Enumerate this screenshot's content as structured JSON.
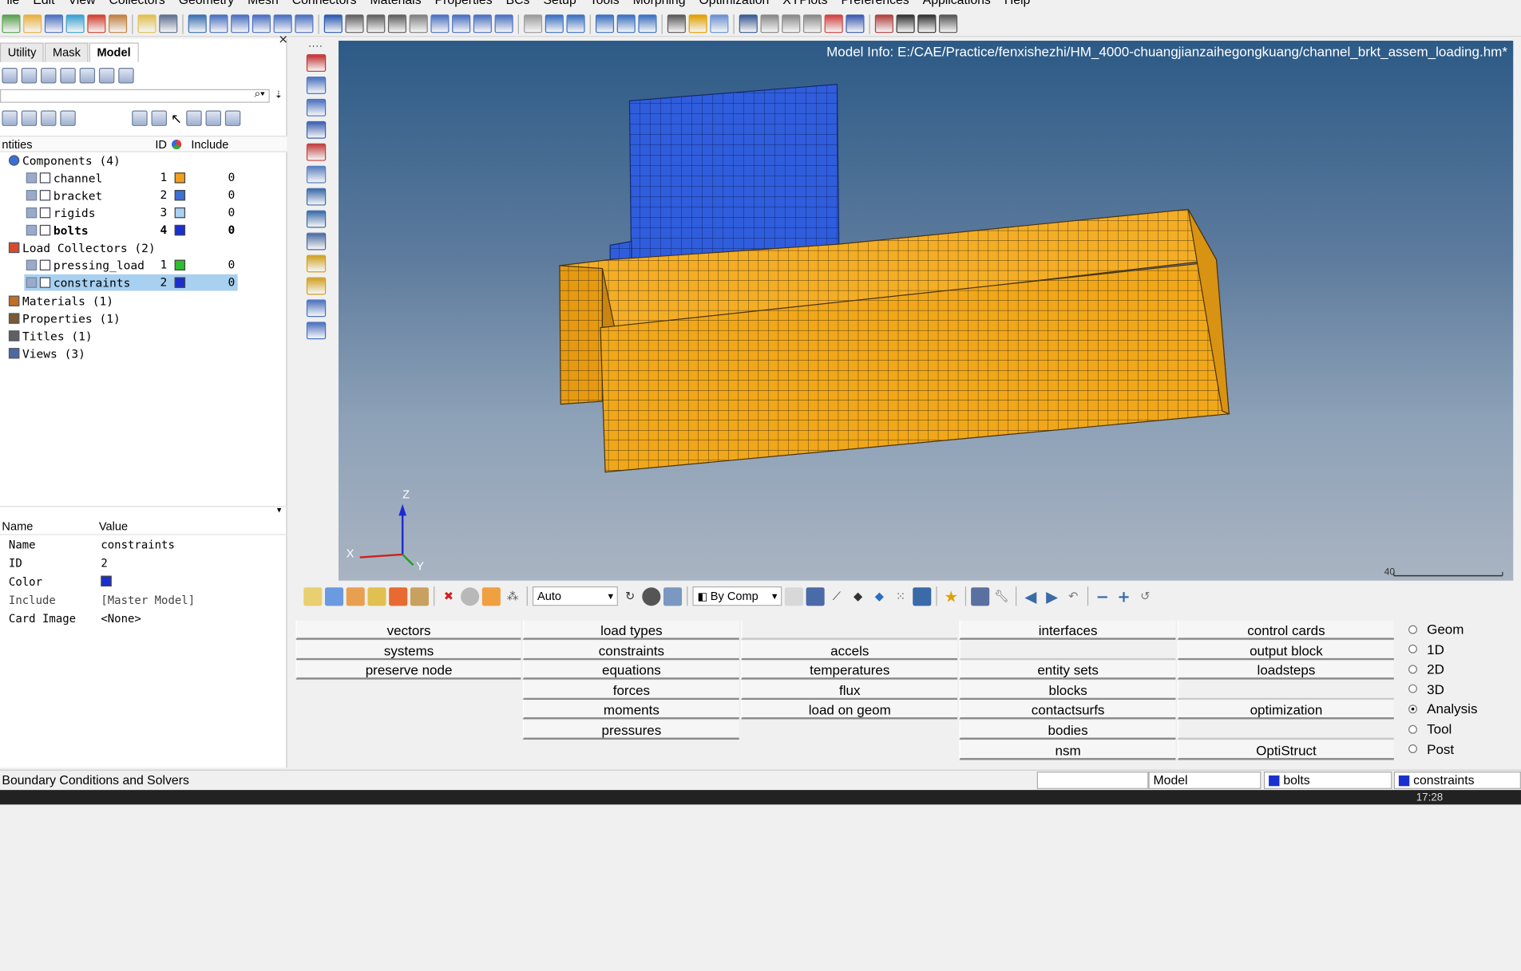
{
  "menu": [
    "ile",
    "Edit",
    "View",
    "Collectors",
    "Geometry",
    "Mesh",
    "Connectors",
    "Materials",
    "Properties",
    "BCs",
    "Setup",
    "Tools",
    "Morphing",
    "Optimization",
    "XYPlots",
    "Preferences",
    "Applications",
    "Help"
  ],
  "left_tabs": [
    "Utility",
    "Mask",
    "Model"
  ],
  "tree": {
    "header": {
      "entities": "ntities",
      "id": "ID",
      "include": "Include"
    },
    "groups": [
      {
        "label": "Components (4)",
        "color": "#3a6fd8"
      },
      {
        "label": "Load Collectors (2)",
        "color": "#d84a2a"
      },
      {
        "label": "Materials (1)",
        "color": "#c07020"
      },
      {
        "label": "Properties (1)",
        "color": "#7a5a30"
      },
      {
        "label": "Titles (1)",
        "color": "#606060"
      },
      {
        "label": "Views (3)",
        "color": "#4a6aa0"
      }
    ],
    "components": [
      {
        "name": "channel",
        "id": "1",
        "color": "#f0a020",
        "include": "0",
        "bold": false
      },
      {
        "name": "bracket",
        "id": "2",
        "color": "#3f6fd0",
        "include": "0",
        "bold": false
      },
      {
        "name": "rigids",
        "id": "3",
        "color": "#a9d0f0",
        "include": "0",
        "bold": false
      },
      {
        "name": "bolts",
        "id": "4",
        "color": "#1a2fcf",
        "include": "0",
        "bold": true
      }
    ],
    "loadcols": [
      {
        "name": "pressing_load",
        "id": "1",
        "color": "#2ebd2e",
        "include": "0"
      },
      {
        "name": "constraints",
        "id": "2",
        "color": "#1a2fcf",
        "include": "0",
        "selected": true
      }
    ]
  },
  "props": {
    "header": {
      "name": "Name",
      "value": "Value"
    },
    "rows": [
      {
        "k": "Name",
        "v": "constraints"
      },
      {
        "k": "ID",
        "v": "2"
      },
      {
        "k": "Color",
        "v": ""
      },
      {
        "k": "Include",
        "v": "[Master Model]"
      },
      {
        "k": "Card Image",
        "v": "<None>"
      }
    ],
    "color_swatch": "#1a2fcf"
  },
  "viewport": {
    "model_info": "Model Info: E:/CAE/Practice/fenxishezhi/HM_4000-chuangjianzaihegongkuang/channel_brkt_assem_loading.hm*",
    "axes": {
      "z": "Z",
      "x": "X",
      "y": "Y"
    },
    "scale_label": "40",
    "channel_color": "#f0a71a",
    "bracket_color": "#2a5ad8"
  },
  "toolbar2": {
    "auto_label": "Auto",
    "bycomp_label": "By Comp"
  },
  "commands": {
    "col1": [
      "vectors",
      "systems",
      "preserve node"
    ],
    "col2": [
      "load types",
      "constraints",
      "equations",
      "forces",
      "moments",
      "pressures"
    ],
    "col3": [
      "",
      "accels",
      "temperatures",
      "flux",
      "load on geom"
    ],
    "col4": [
      "interfaces",
      "",
      "entity sets",
      "blocks",
      "contactsurfs",
      "bodies",
      "nsm"
    ],
    "col5": [
      "control cards",
      "output block",
      "loadsteps",
      "",
      "optimization",
      "",
      "OptiStruct"
    ]
  },
  "radios": [
    {
      "label": "Geom",
      "on": false
    },
    {
      "label": "1D",
      "on": false
    },
    {
      "label": "2D",
      "on": false
    },
    {
      "label": "3D",
      "on": false
    },
    {
      "label": "Analysis",
      "on": true
    },
    {
      "label": "Tool",
      "on": false
    },
    {
      "label": "Post",
      "on": false
    }
  ],
  "status": {
    "left": "Boundary Conditions and Solvers",
    "model": "Model",
    "component": "bolts",
    "loadcol": "constraints"
  },
  "clock": "17:28"
}
